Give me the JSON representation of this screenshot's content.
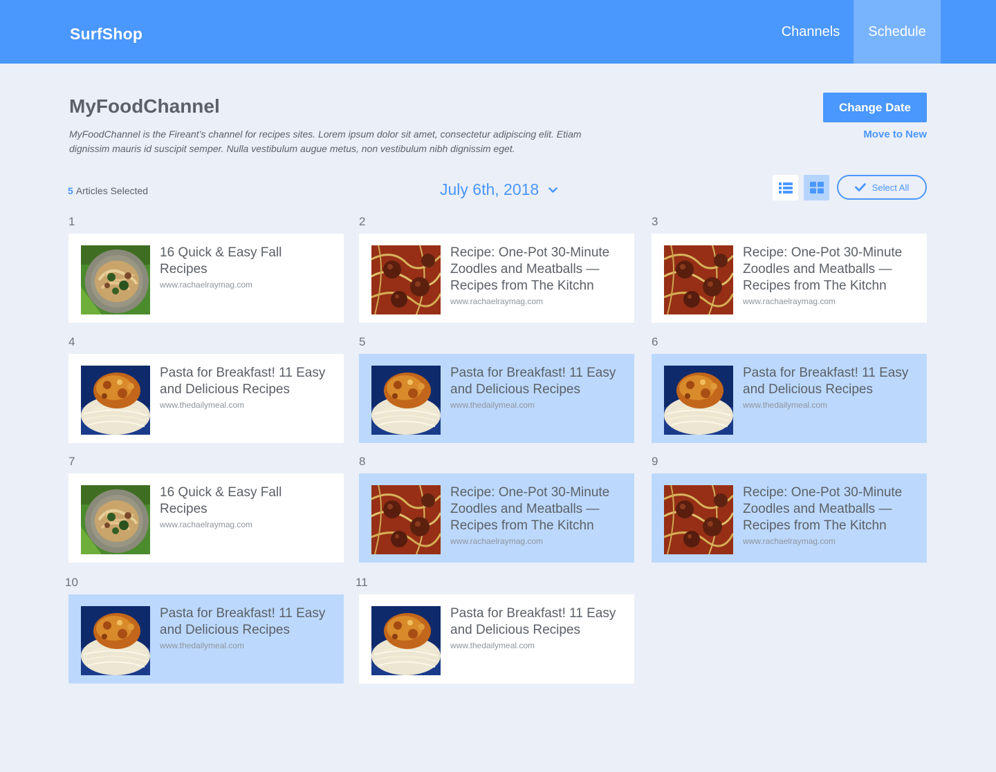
{
  "app": {
    "name": "SurfShop"
  },
  "nav": {
    "channels": "Channels",
    "schedule": "Schedule"
  },
  "channel": {
    "title": "MyFoodChannel",
    "description": "MyFoodChannel is the Fireant’s channel for recipes sites. Lorem ipsum dolor sit amet, consectetur adipiscing elit. Etiam dignissim mauris id suscipit semper. Nulla vestibulum augue metus, non vestibulum nibh dignissim eget."
  },
  "actions": {
    "change_date": "Change Date",
    "move_to_new": "Move to New",
    "select_all": "Select All"
  },
  "selection": {
    "count": "5",
    "label": "Articles Selected"
  },
  "date": {
    "value": "July 6th, 2018"
  },
  "icons": {
    "list_view": "list-icon",
    "grid_view": "grid-icon",
    "select_all": "check-icon",
    "date_dropdown": "chevron-down-icon"
  },
  "colors": {
    "accent": "#4a97fd",
    "nav_active": "#78b3fe",
    "selected_card": "#bcd9fd",
    "background": "#ebeff7"
  },
  "articles": [
    {
      "number": "1",
      "title": "16 Quick & Easy Fall Recipes",
      "source": "www.rachaelraymag.com",
      "image": "pasta-greens",
      "selected": false
    },
    {
      "number": "2",
      "title": "Recipe: One-Pot 30-Minute Zoodles and Meatballs — Recipes from The Kitchn",
      "source": "www.rachaelraymag.com",
      "image": "meatballs",
      "selected": false
    },
    {
      "number": "3",
      "title": "Recipe: One-Pot 30-Minute Zoodles and Meatballs — Recipes from The Kitchn",
      "source": "www.rachaelraymag.com",
      "image": "meatballs",
      "selected": false
    },
    {
      "number": "4",
      "title": "Pasta for Breakfast! 11 Easy and Delicious Recipes",
      "source": "www.thedailymeal.com",
      "image": "pasta-plate",
      "selected": false
    },
    {
      "number": "5",
      "title": "Pasta for Breakfast! 11 Easy and Delicious Recipes",
      "source": "www.thedailymeal.com",
      "image": "pasta-plate",
      "selected": true
    },
    {
      "number": "6",
      "title": "Pasta for Breakfast! 11 Easy and Delicious Recipes",
      "source": "www.thedailymeal.com",
      "image": "pasta-plate",
      "selected": true
    },
    {
      "number": "7",
      "title": "16 Quick & Easy Fall Recipes",
      "source": "www.rachaelraymag.com",
      "image": "pasta-greens",
      "selected": false
    },
    {
      "number": "8",
      "title": "Recipe: One-Pot 30-Minute Zoodles and Meatballs — Recipes from The Kitchn",
      "source": "www.rachaelraymag.com",
      "image": "meatballs",
      "selected": true
    },
    {
      "number": "9",
      "title": "Recipe: One-Pot 30-Minute Zoodles and Meatballs — Recipes from The Kitchn",
      "source": "www.rachaelraymag.com",
      "image": "meatballs",
      "selected": true
    },
    {
      "number": "10",
      "title": "Pasta for Breakfast! 11 Easy and Delicious Recipes",
      "source": "www.thedailymeal.com",
      "image": "pasta-plate",
      "selected": true
    },
    {
      "number": "11",
      "title": "Pasta for Breakfast! 11 Easy and Delicious Recipes",
      "source": "www.thedailymeal.com",
      "image": "pasta-plate",
      "selected": false
    }
  ]
}
